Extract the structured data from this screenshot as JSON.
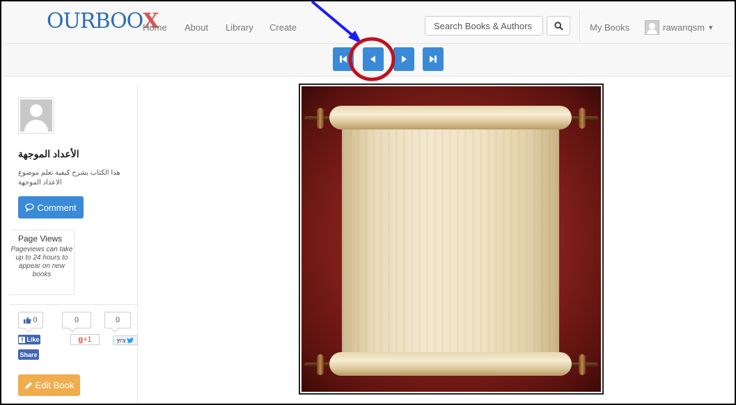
{
  "navbar": {
    "logo_text": "OURBOO",
    "logo_x": "X",
    "links": [
      "Home",
      "About",
      "Library",
      "Create"
    ],
    "search_placeholder": "Search Books & Authors",
    "my_books": "My Books",
    "username": "rawanqsm",
    "caret": "▾"
  },
  "pager": {
    "buttons": [
      "first-page",
      "previous-page",
      "next-page",
      "last-page"
    ]
  },
  "sidebar": {
    "book_title": "الأعداد الموجهة",
    "book_description": "هذا الكتاب يشرح كيفية تعلم موضوع الاعداد الموجهة",
    "comment_label": "Comment",
    "page_views_title": "Page Views",
    "page_views_note": "Pageviews can take up to 24 hours to appear on new books",
    "like_count": "0",
    "gplus_count": "0",
    "tweet_count": "0",
    "fb_like_label": "Like",
    "fb_share_label": "Share",
    "gplus_label": "+1",
    "tweet_label": "ציוץ",
    "edit_label": "Edit Book"
  },
  "colors": {
    "primary": "#3a8ad8",
    "warning": "#f0ad4e",
    "facebook": "#4267b2",
    "annotation_arrow": "#1a1aff",
    "annotation_circle": "#c0121c"
  }
}
